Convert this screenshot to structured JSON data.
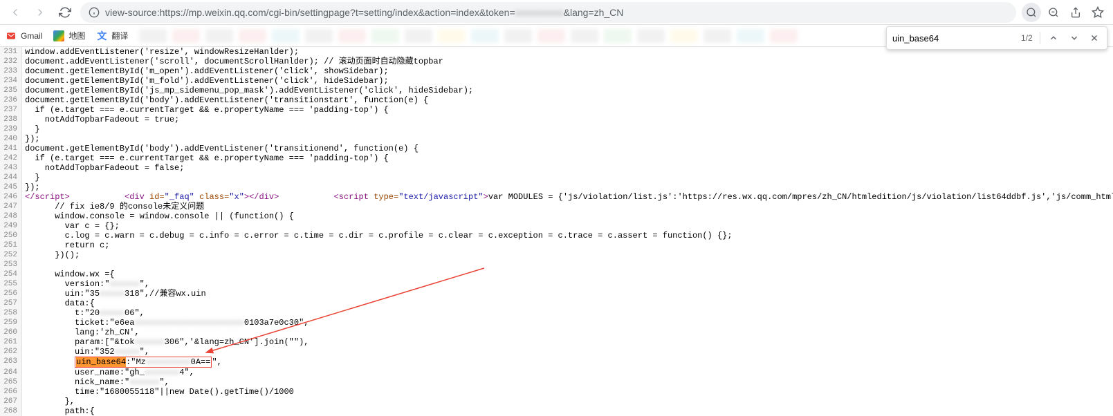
{
  "toolbar": {
    "url": "view-source:https://mp.weixin.qq.com/cgi-bin/settingpage?t=setting/index&action=index&token=",
    "url_suffix": "&lang=zh_CN"
  },
  "bookmarks": {
    "gmail": "Gmail",
    "map": "地图",
    "translate": "翻译"
  },
  "find": {
    "query": "uin_base64",
    "count": "1/2"
  },
  "lines": [
    {
      "n": 231,
      "raw": "window.addEventListener('resize', windowResizeHanlder);"
    },
    {
      "n": 232,
      "raw": "document.addEventListener('scroll', documentScrollHanlder); // 滚动页面时自动隐藏topbar"
    },
    {
      "n": 233,
      "raw": "document.getElementById('m_open').addEventListener('click', showSidebar);"
    },
    {
      "n": 234,
      "raw": "document.getElementById('m_fold').addEventListener('click', hideSidebar);"
    },
    {
      "n": 235,
      "raw": "document.getElementById('js_mp_sidemenu_pop_mask').addEventListener('click', hideSidebar);"
    },
    {
      "n": 236,
      "raw": "document.getElementById('body').addEventListener('transitionstart', function(e) {"
    },
    {
      "n": 237,
      "raw": "  if (e.target === e.currentTarget && e.propertyName === 'padding-top') {"
    },
    {
      "n": 238,
      "raw": "    notAddTopbarFadeout = true;"
    },
    {
      "n": 239,
      "raw": "  }"
    },
    {
      "n": 240,
      "raw": "});"
    },
    {
      "n": 241,
      "raw": "document.getElementById('body').addEventListener('transitionend', function(e) {"
    },
    {
      "n": 242,
      "raw": "  if (e.target === e.currentTarget && e.propertyName === 'padding-top') {"
    },
    {
      "n": 243,
      "raw": "    notAddTopbarFadeout = false;"
    },
    {
      "n": 244,
      "raw": "  }"
    },
    {
      "n": 245,
      "raw": "});"
    }
  ],
  "line246": {
    "close_script": "</script​>",
    "div_open": "<div",
    "id_attr": " id=",
    "id_val": "\"_faq\"",
    "class_attr": " class=",
    "class_val": "\"x\"",
    "div_close": "></div>",
    "script_open": "<script",
    "type_attr": " type=",
    "type_val": "\"text/javascript\"",
    "gt": ">",
    "modules": "var MODULES = {'js/violation/list.js':'https://res.wx.qq.com/mpres/zh_CN/htmledition/js/violation/list64ddbf.js','js/comm_htmledition/style/page/violation/list.less.js':'https://res."
  },
  "lines2": [
    {
      "n": 247,
      "raw": "      // fix ie8/9 的console未定义问题"
    },
    {
      "n": 248,
      "raw": "      window.console = window.console || (function() {"
    },
    {
      "n": 249,
      "raw": "        var c = {};"
    },
    {
      "n": 250,
      "raw": "        c.log = c.warn = c.debug = c.info = c.error = c.time = c.dir = c.profile = c.clear = c.exception = c.trace = c.assert = function() {};"
    },
    {
      "n": 251,
      "raw": "        return c;"
    },
    {
      "n": 252,
      "raw": "      })();"
    },
    {
      "n": 253,
      "raw": ""
    },
    {
      "n": 254,
      "raw": "      window.wx ={"
    },
    {
      "n": 255,
      "raw": "        version:\"",
      "redacted": "xxxxxx",
      "tail": "\","
    },
    {
      "n": 256,
      "raw": "        uin:\"35",
      "redacted": "xxxxx",
      "tail": "318\",//兼容wx.uin"
    },
    {
      "n": 257,
      "raw": "        data:{"
    },
    {
      "n": 258,
      "raw": "          t:\"20",
      "redacted": "xxxxx",
      "tail": "06\","
    },
    {
      "n": 259,
      "raw": "          ticket:\"e6ea",
      "redacted": "xxxxxxxxxxxxxxxxxxxxxx",
      "tail": "0103a7e0c30\","
    },
    {
      "n": 260,
      "raw": "          lang:'zh_CN',"
    },
    {
      "n": 261,
      "raw": "          param:[\"&tok",
      "redacted": "xxxxxx",
      "tail": "306\",'&lang=zh_CN'].join(\"\"),"
    },
    {
      "n": 262,
      "raw": "          uin:\"352",
      "redacted": "xxxxx",
      "tail": "\","
    }
  ],
  "line263": {
    "indent": "          ",
    "key": "uin_base64",
    "sep": ":\"",
    "val_prefix": "Mz",
    "val_redacted": "xxxxxxxxx",
    "val_suffix": "0A==",
    "tail": "\","
  },
  "lines3": [
    {
      "n": 264,
      "raw": "          user_name:\"gh_",
      "redacted": "xxxxxxx",
      "tail": "4\","
    },
    {
      "n": 265,
      "raw": "          nick_name:\"",
      "redacted": "xxxxxx",
      "tail": "\","
    },
    {
      "n": 266,
      "raw": "          time:\"1680055118\"||new Date().getTime()/1000"
    },
    {
      "n": 267,
      "raw": "        },"
    },
    {
      "n": 268,
      "raw": "        path:{"
    }
  ]
}
